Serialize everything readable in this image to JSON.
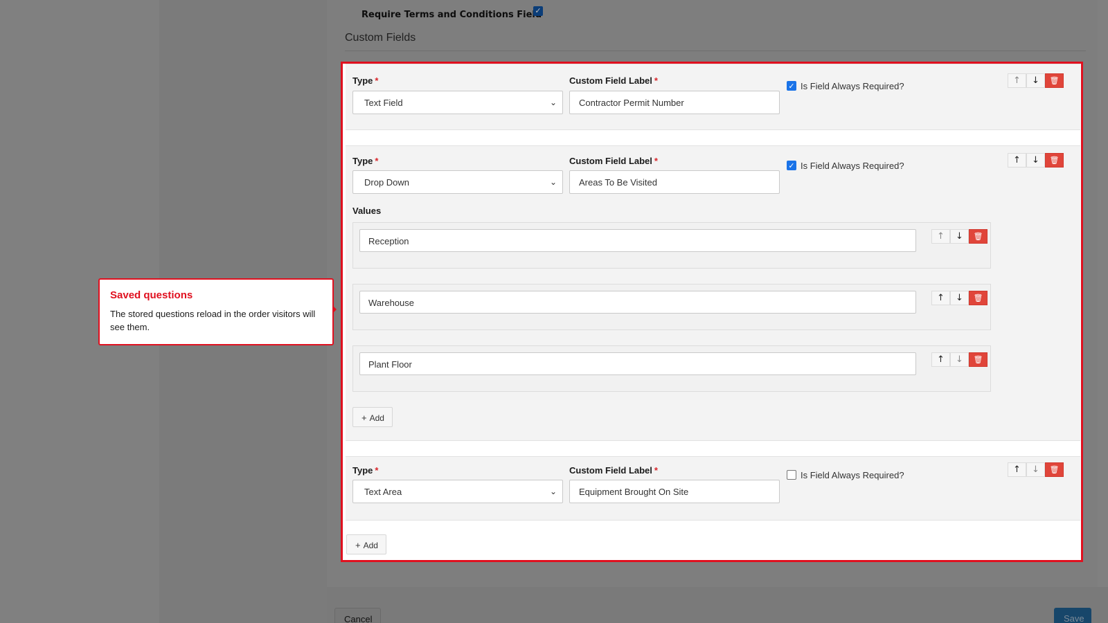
{
  "form": {
    "terms_label": "Require Terms and Conditions Field",
    "terms_checked": true,
    "section_title": "Custom Fields",
    "type_label": "Type",
    "label_label": "Custom Field Label",
    "required_mark": "*",
    "always_required_label": "Is Field Always Required?",
    "values_label": "Values",
    "add_label": "Add"
  },
  "fields": [
    {
      "type": "Text Field",
      "label": "Contractor Permit Number",
      "always_required": true
    },
    {
      "type": "Drop Down",
      "label": "Areas To Be Visited",
      "always_required": true,
      "values": [
        "Reception",
        "Warehouse",
        "Plant Floor"
      ]
    },
    {
      "type": "Text Area",
      "label": "Equipment Brought On Site",
      "always_required": false
    }
  ],
  "tooltip": {
    "title": "Saved questions",
    "body": "The stored questions reload in the order visitors will see them."
  },
  "footer": {
    "cancel_label": "Cancel",
    "save_label": "Save"
  },
  "icons": {
    "up": "arrow-up-icon",
    "down": "arrow-down-icon",
    "delete": "trash-icon",
    "add": "plus-icon",
    "select": "chevron-down-icon",
    "check": "checkmark-icon"
  },
  "colors": {
    "highlight": "#e0101f",
    "delete_button": "#e0453a",
    "checkbox": "#1a73e8",
    "save_button": "#17466a"
  }
}
